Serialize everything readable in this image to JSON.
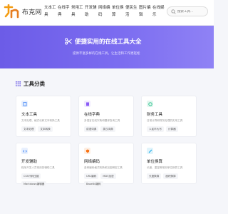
{
  "header": {
    "logo_text": "布克网",
    "nav": [
      "文本工具",
      "在线字典",
      "常用工具",
      "开发辅助",
      "网络编码",
      "单位换算",
      "便民生活",
      "图片编辑",
      "在线娱乐",
      "图优团队"
    ],
    "search_placeholder": "搜索工具..."
  },
  "hero": {
    "title": "便捷实用的在线工具大全",
    "subtitle": "提供丰富多样的在线工具，让生活和工作更轻松"
  },
  "section": {
    "title": "工具分类"
  },
  "categories": [
    {
      "title": "文本工具",
      "desc": "文本处理、格式化和文本转换工具",
      "links": [
        "文本处理",
        "文本转换"
      ],
      "color": "#3b82f6"
    },
    {
      "title": "在线字典",
      "desc": "多语言在线字典和翻译查询工具",
      "links": [
        "成语词典",
        "英汉词典"
      ],
      "color": "#8b5cf6"
    },
    {
      "title": "财务工具",
      "desc": "日常计算和财务处理的实用工具",
      "links": [
        "人民币大写",
        "计算器"
      ],
      "color": "#10b981"
    },
    {
      "title": "开发辅助",
      "desc": "程序开发人员常用的辅助工具",
      "links": [
        "CSS代码压缩",
        "Markdown编辑器"
      ],
      "color": "#3b82f6"
    },
    {
      "title": "网络编码",
      "desc": "各种编码格式转换和加密解密工具",
      "links": [
        "URL编码",
        "MD5加密",
        "Base64编码"
      ],
      "color": "#f97316"
    },
    {
      "title": "单位换算",
      "desc": "长度、重量等常用单位换算工具",
      "links": [
        "长度换算",
        "面积换算"
      ],
      "color": "#0ea5e9"
    }
  ]
}
